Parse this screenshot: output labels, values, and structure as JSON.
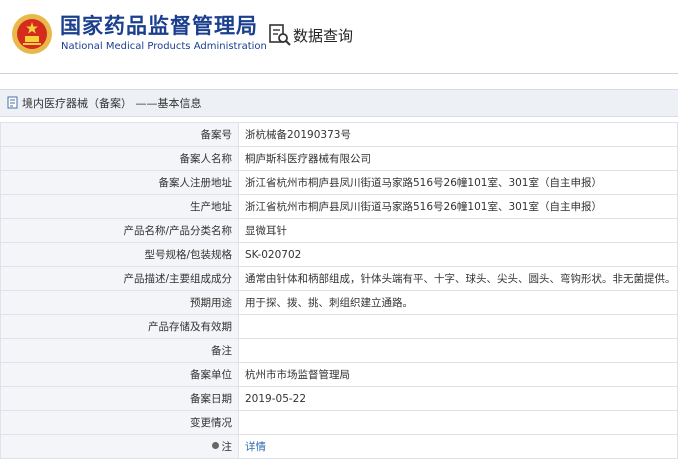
{
  "header": {
    "org_name_cn": "国家药品监督管理局",
    "org_name_en": "National Medical Products Administration",
    "query_title": "数据查询"
  },
  "breadcrumb": {
    "text": "境内医疗器械（备案） ——基本信息"
  },
  "rows": [
    {
      "label": "备案号",
      "value": "浙杭械备20190373号"
    },
    {
      "label": "备案人名称",
      "value": "桐庐斯科医疗器械有限公司"
    },
    {
      "label": "备案人注册地址",
      "value": "浙江省杭州市桐庐县凤川街道马家路516号26幢101室、301室（自主申报）"
    },
    {
      "label": "生产地址",
      "value": "浙江省杭州市桐庐县凤川街道马家路516号26幢101室、301室（自主申报）"
    },
    {
      "label": "产品名称/产品分类名称",
      "value": "显微耳针"
    },
    {
      "label": "型号规格/包装规格",
      "value": "SK-020702"
    },
    {
      "label": "产品描述/主要组成成分",
      "value": "通常由针体和柄部组成，针体头端有平、十字、球头、尖头、圆头、弯钩形状。非无菌提供。"
    },
    {
      "label": "预期用途",
      "value": "用于探、拨、挑、刺组织建立通路。"
    },
    {
      "label": "产品存储及有效期",
      "value": ""
    },
    {
      "label": "备注",
      "value": ""
    },
    {
      "label": "备案单位",
      "value": "杭州市市场监督管理局"
    },
    {
      "label": "备案日期",
      "value": "2019-05-22"
    },
    {
      "label": "变更情况",
      "value": ""
    },
    {
      "label": "注",
      "value": "详情"
    }
  ],
  "colors": {
    "brand_blue": "#1b3f8f",
    "emblem_red": "#d52b1e",
    "link_blue": "#2f6db5"
  }
}
